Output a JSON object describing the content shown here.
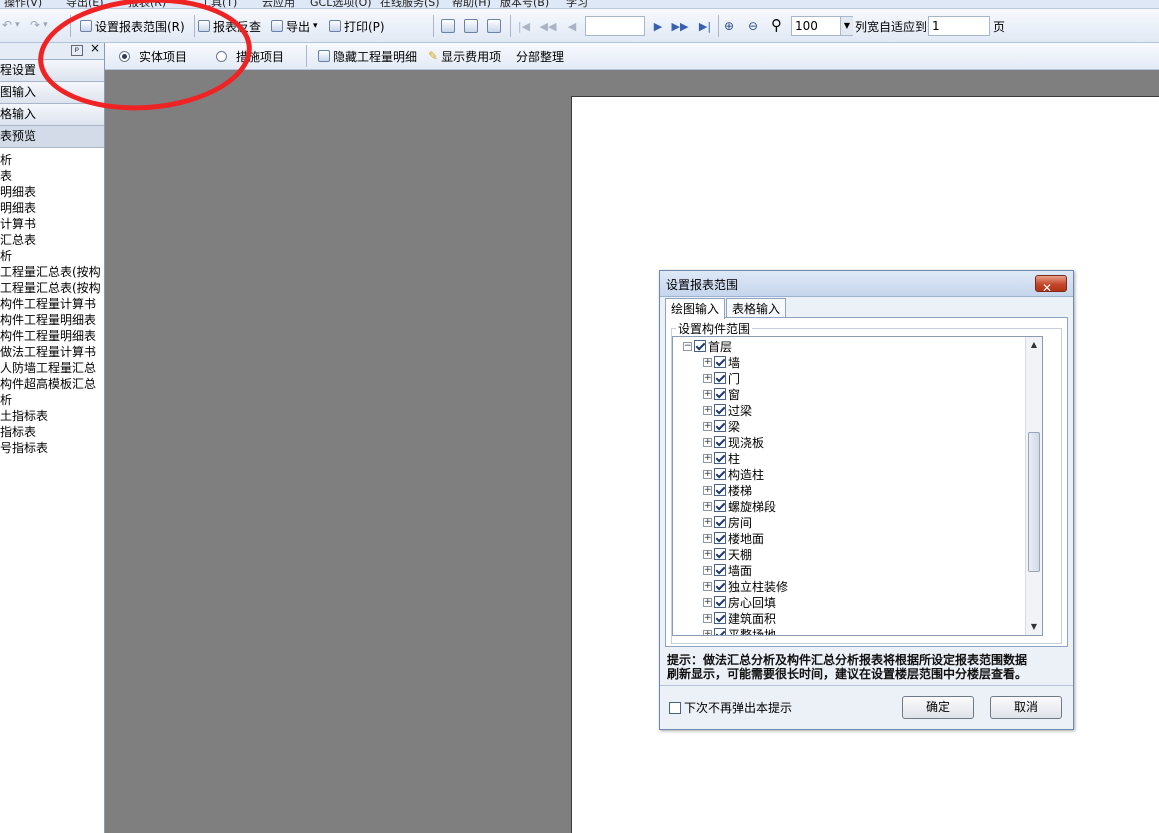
{
  "menubar": {
    "items": [
      "操作(V)",
      "导出(E)",
      "报表(R)",
      "工具(T)",
      "云应用",
      "GCL选项(O)",
      "在线服务(S)",
      "帮助(H)",
      "版本号(B)",
      "学习"
    ]
  },
  "toolbar1": {
    "set_range_label": "设置报表范围(R)",
    "report_check_label": "报表反查",
    "export_label": "导出",
    "print_label": "打印(P)",
    "page_input_value": "",
    "zoom_value": "100",
    "fit_label": "列宽自适应到",
    "fit_value": "1",
    "page_unit": "页"
  },
  "toolbar2": {
    "radio_entity": "实体项目",
    "radio_measure": "措施项目",
    "hide_detail": "隐藏工程量明细",
    "show_cost": "显示费用项",
    "section_sort": "分部整理"
  },
  "sidebar": {
    "pin_glyph": "ᵖ",
    "close_glyph": "×",
    "sections": [
      "程设置",
      "图输入",
      "格输入",
      "表预览"
    ],
    "items": [
      "析",
      "表",
      "明细表",
      "明细表",
      "计算书",
      "汇总表",
      "析",
      "工程量汇总表(按构",
      "工程量汇总表(按构",
      "构件工程量计算书",
      "构件工程量明细表",
      "构件工程量明细表",
      "做法工程量计算书",
      "人防墙工程量汇总",
      "构件超高模板汇总",
      "析",
      "土指标表",
      "指标表",
      "号指标表"
    ]
  },
  "dialog": {
    "title": "设置报表范围",
    "close_glyph": "✕",
    "tabs": [
      "绘图输入",
      "表格输入"
    ],
    "group_label": "设置构件范围",
    "root": {
      "label": "首层",
      "checked": true
    },
    "tree_items": [
      {
        "label": "墙",
        "checked": true
      },
      {
        "label": "门",
        "checked": true
      },
      {
        "label": "窗",
        "checked": true
      },
      {
        "label": "过梁",
        "checked": true
      },
      {
        "label": "梁",
        "checked": true
      },
      {
        "label": "现浇板",
        "checked": true
      },
      {
        "label": "柱",
        "checked": true
      },
      {
        "label": "构造柱",
        "checked": true
      },
      {
        "label": "楼梯",
        "checked": true
      },
      {
        "label": "螺旋梯段",
        "checked": true
      },
      {
        "label": "房间",
        "checked": true
      },
      {
        "label": "楼地面",
        "checked": true
      },
      {
        "label": "天棚",
        "checked": true
      },
      {
        "label": "墙面",
        "checked": true
      },
      {
        "label": "独立柱装修",
        "checked": true
      },
      {
        "label": "房心回填",
        "checked": true
      },
      {
        "label": "建筑面积",
        "checked": true
      },
      {
        "label": "平整场地",
        "checked": true
      }
    ],
    "hint_line1": "提示：做法汇总分析及构件汇总分析报表将根据所设定报表范围数据",
    "hint_line2": "刷新显示，可能需要很长时间，建议在设置楼层范围中分楼层查看。",
    "no_show_label": "下次不再弹出本提示",
    "ok_label": "确定",
    "cancel_label": "取消"
  },
  "colors": {
    "workspace": "#7f7f7f",
    "annotation_red": "#ef2323",
    "close_button": "#c5472b"
  }
}
